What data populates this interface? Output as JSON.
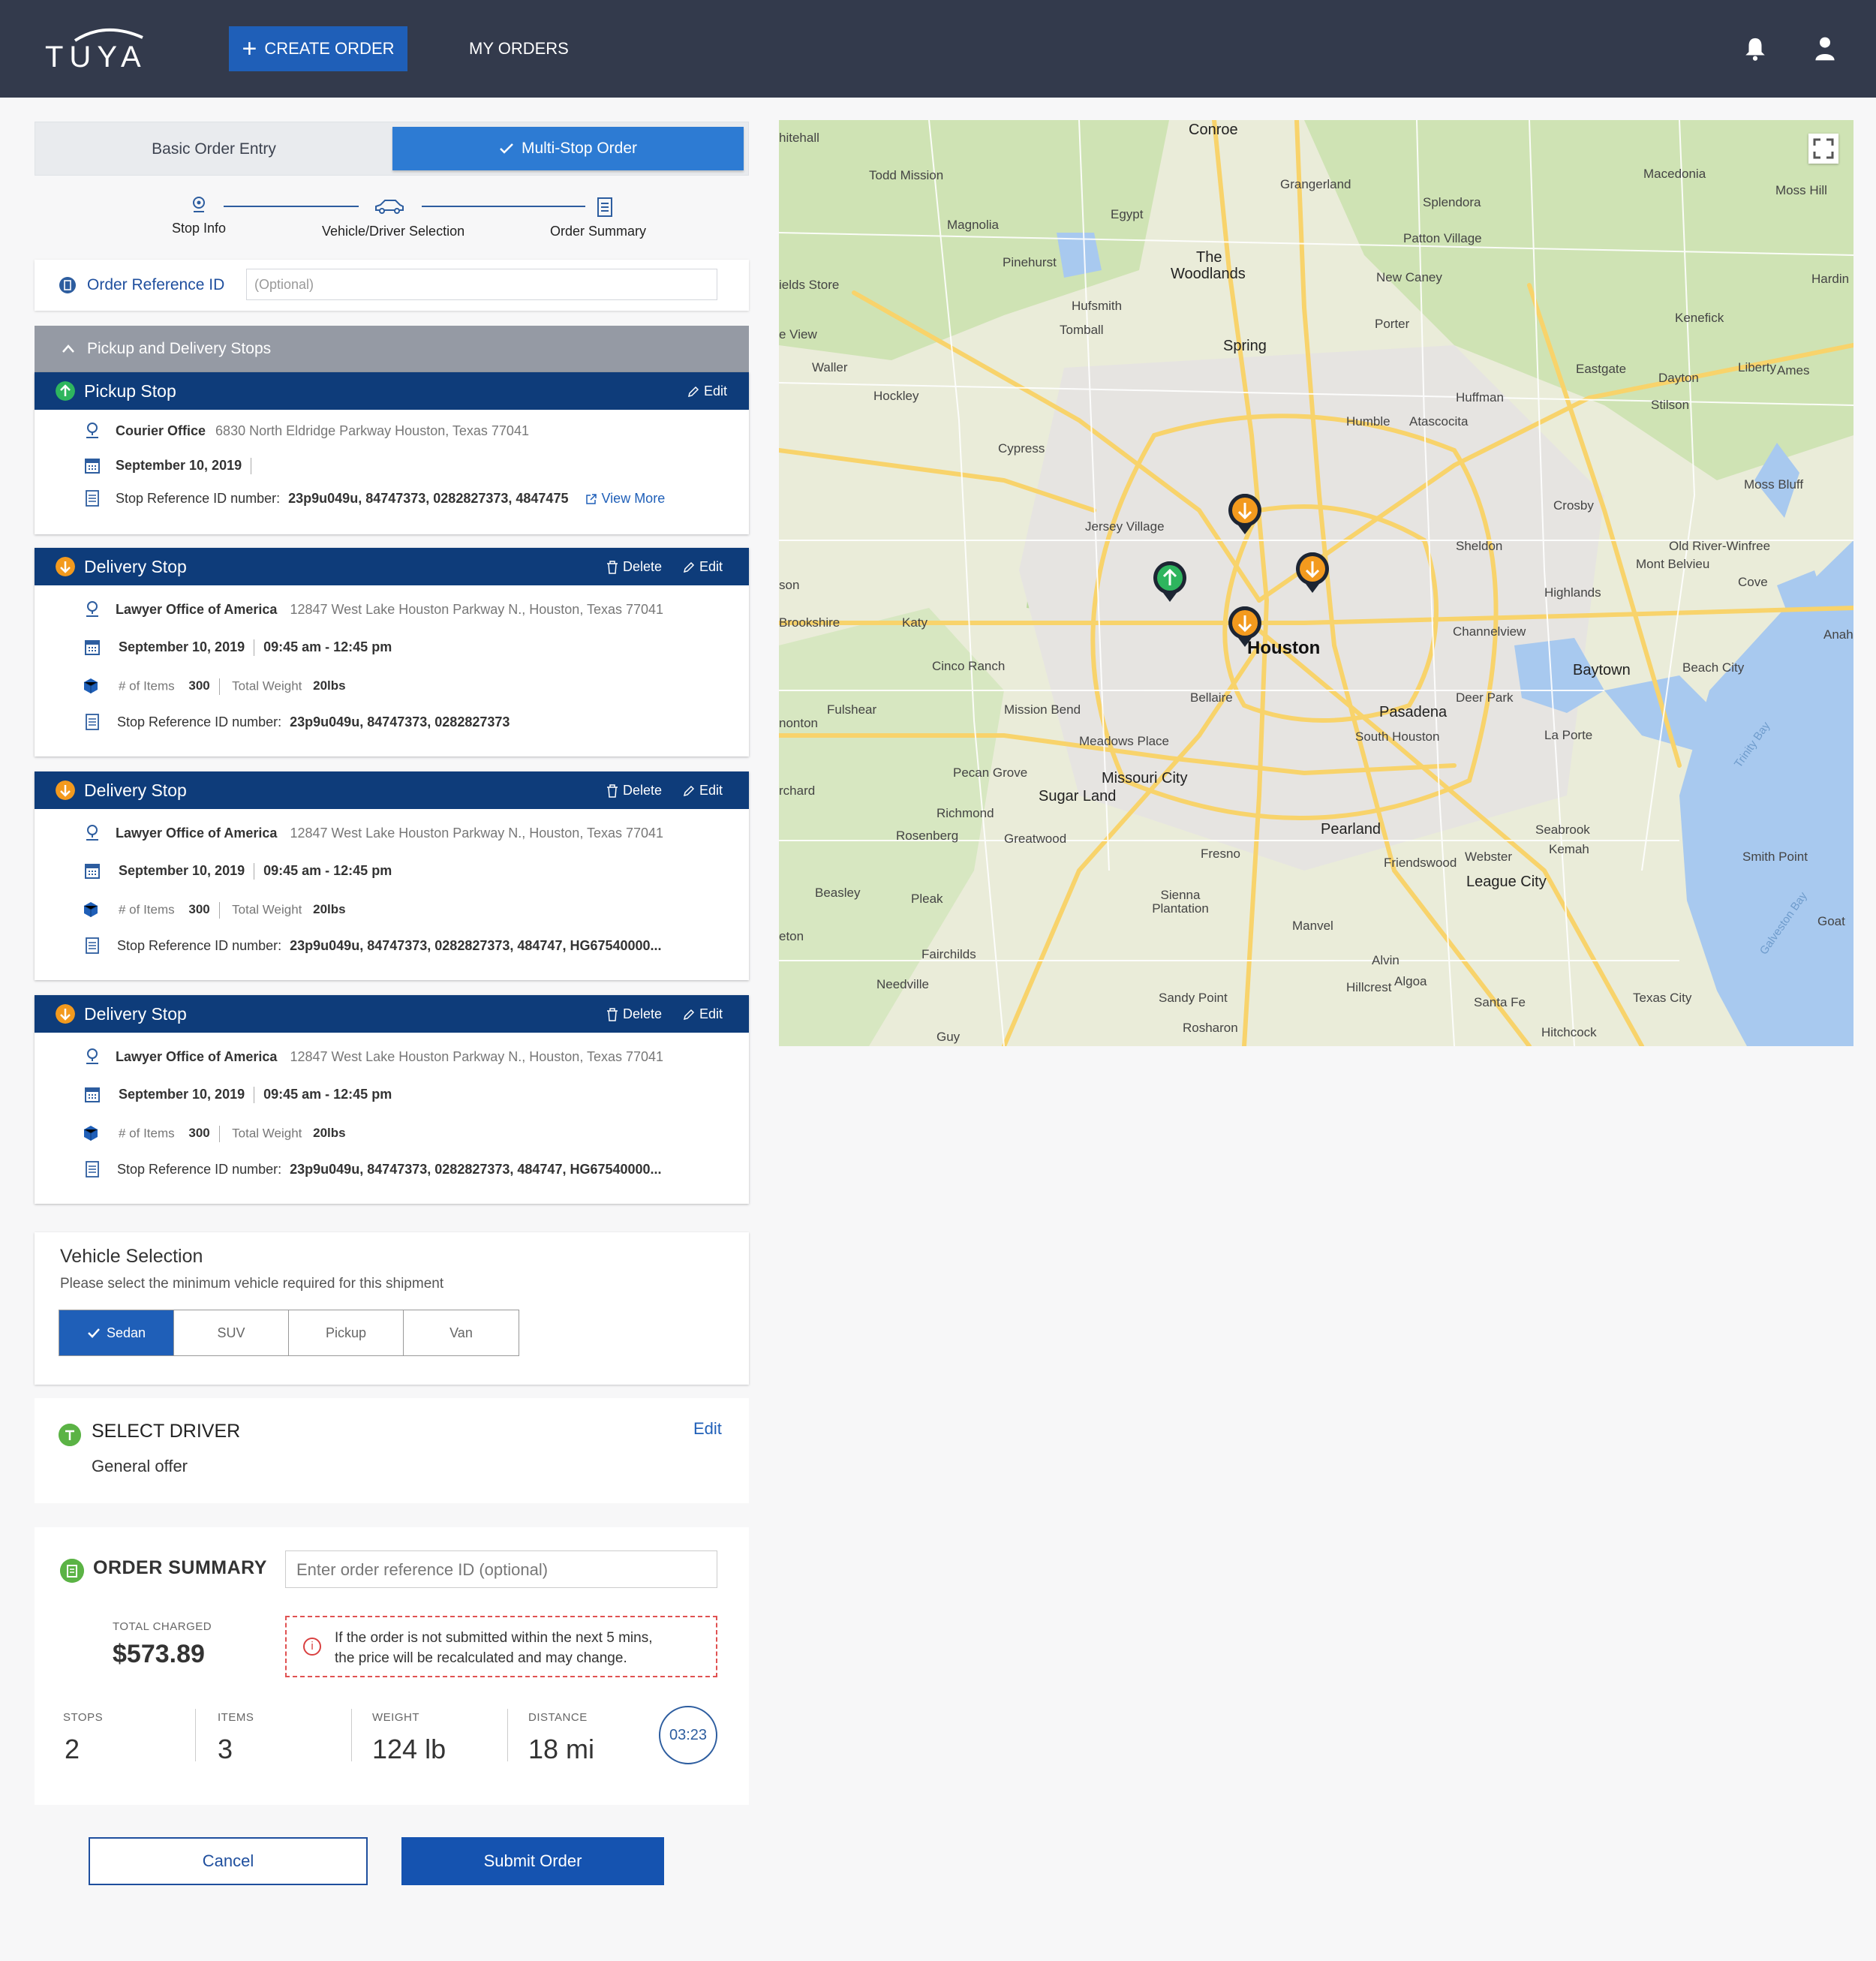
{
  "header": {
    "brand": "TUYA",
    "create_order": "CREATE ORDER",
    "my_orders": "MY ORDERS",
    "notifications_icon": "bell-icon",
    "account_icon": "user-icon"
  },
  "order_mode": {
    "basic": "Basic Order Entry",
    "multi": "Multi-Stop Order",
    "selected": "multi"
  },
  "steps": [
    "Stop Info",
    "Vehicle/Driver Selection",
    "Order Summary"
  ],
  "order_reference": {
    "label": "Order Reference ID",
    "placeholder": "(Optional)"
  },
  "stops_section": {
    "title": "Pickup and Delivery Stops",
    "pickup": {
      "title": "Pickup Stop",
      "edit": "Edit",
      "place": "Courier Office",
      "address": "6830 North Eldridge Parkway  Houston, Texas 77041",
      "date": "September 10, 2019",
      "ref_label": "Stop Reference ID number:",
      "ref_value": "23p9u049u, 84747373, 0282827373, 4847475",
      "view_more": "View More"
    },
    "deliveries": [
      {
        "title": "Delivery Stop",
        "delete": "Delete",
        "edit": "Edit",
        "place": "Lawyer Office of America",
        "address": "12847 West Lake Houston Parkway N., Houston, Texas 77041",
        "date": "September 10, 2019",
        "time": "09:45 am - 12:45 pm",
        "items_label": "# of Items",
        "items": "300",
        "weight_label": "Total Weight",
        "weight": "20lbs",
        "ref_label": "Stop Reference ID number:",
        "ref_value": "23p9u049u, 84747373, 0282827373"
      },
      {
        "title": "Delivery Stop",
        "delete": "Delete",
        "edit": "Edit",
        "place": "Lawyer Office of America",
        "address": "12847 West Lake Houston Parkway N., Houston, Texas 77041",
        "date": "September 10, 2019",
        "time": "09:45 am - 12:45 pm",
        "items_label": "# of Items",
        "items": "300",
        "weight_label": "Total Weight",
        "weight": "20lbs",
        "ref_label": "Stop Reference ID number:",
        "ref_value": "23p9u049u, 84747373, 0282827373, 484747, HG67540000..."
      },
      {
        "title": "Delivery Stop",
        "delete": "Delete",
        "edit": "Edit",
        "place": "Lawyer Office of America",
        "address": "12847 West Lake Houston Parkway N., Houston, Texas 77041",
        "date": "September 10, 2019",
        "time": "09:45 am - 12:45 pm",
        "items_label": "# of Items",
        "items": "300",
        "weight_label": "Total Weight",
        "weight": "20lbs",
        "ref_label": "Stop Reference ID number:",
        "ref_value": "23p9u049u, 84747373, 0282827373, 484747, HG67540000..."
      }
    ]
  },
  "vehicle": {
    "title": "Vehicle Selection",
    "subtitle": "Please select the minimum vehicle required for this shipment",
    "options": [
      "Sedan",
      "SUV",
      "Pickup",
      "Van"
    ],
    "selected": "Sedan"
  },
  "driver": {
    "title": "SELECT DRIVER",
    "value": "General offer",
    "edit": "Edit"
  },
  "summary": {
    "title": "ORDER SUMMARY",
    "ref_placeholder": "Enter order reference ID (optional)",
    "total_label": "TOTAL CHARGED",
    "total": "$573.89",
    "warning": [
      "If the order is not submitted within the next 5 mins,",
      "the price will be recalculated and may change."
    ],
    "stats": [
      {
        "label": "STOPS",
        "value": "2"
      },
      {
        "label": "ITEMS",
        "value": "3"
      },
      {
        "label": "WEIGHT",
        "value": "124 lb"
      },
      {
        "label": "DISTANCE",
        "value": "18 mi"
      }
    ],
    "timer": "03:23"
  },
  "actions": {
    "cancel": "Cancel",
    "submit": "Submit Order"
  },
  "map": {
    "labels": [
      "hitehall",
      "Conroe",
      "Todd Mission",
      "Grangerland",
      "Macedonia",
      "Moss Hill",
      "Splendora",
      "Egypt",
      "Magnolia",
      "Patton Village",
      "Pinehurst",
      "The",
      "Woodlands",
      "ields Store",
      "New Caney",
      "Hardin",
      "Hufsmith",
      "Tomball",
      "Porter",
      "e View",
      "Kenefick",
      "Waller",
      "Spring",
      "Eastgate",
      "Dayton",
      "Liberty",
      "Ames",
      "Hockley",
      "Huffman",
      "Stilson",
      "Humble",
      "Atascocita",
      "Cypress",
      "Moss Bluff",
      "Crosby",
      "Jersey Village",
      "Sheldon",
      "Old River-Winfree",
      "Mont Belvieu",
      "son",
      "Highlands",
      "Cove",
      "Brookshire",
      "Katy",
      "Channelview",
      "Anahu",
      "Baytown",
      "Beach City",
      "Houston",
      "Cinco Ranch",
      "Deer Park",
      "Fulshear",
      "Bellaire",
      "Pasadena",
      "Mission Bend",
      "nonton",
      "Meadows Place",
      "South Houston",
      "La Porte",
      "Pecan Grove",
      "Missouri City",
      "Sugar Land",
      "Trinity Bay",
      "Richmond",
      "Pearland",
      "Seabrook",
      "Rosenberg",
      "Greatwood",
      "Kemah",
      "Fresno",
      "Friendswood",
      "Webster",
      "Smith Point",
      "Beasley",
      "League City",
      "Pleak",
      "Sienna Plantation",
      "eton",
      "Manvel",
      "Galveston Bay",
      "Goat",
      "Fairchilds",
      "Alvin",
      "Needville",
      "Hillcrest",
      "Algoa",
      "Sandy Point",
      "Santa Fe",
      "Texas City",
      "Rosharon",
      "Hitchcock",
      "Guy",
      "rchard"
    ]
  }
}
